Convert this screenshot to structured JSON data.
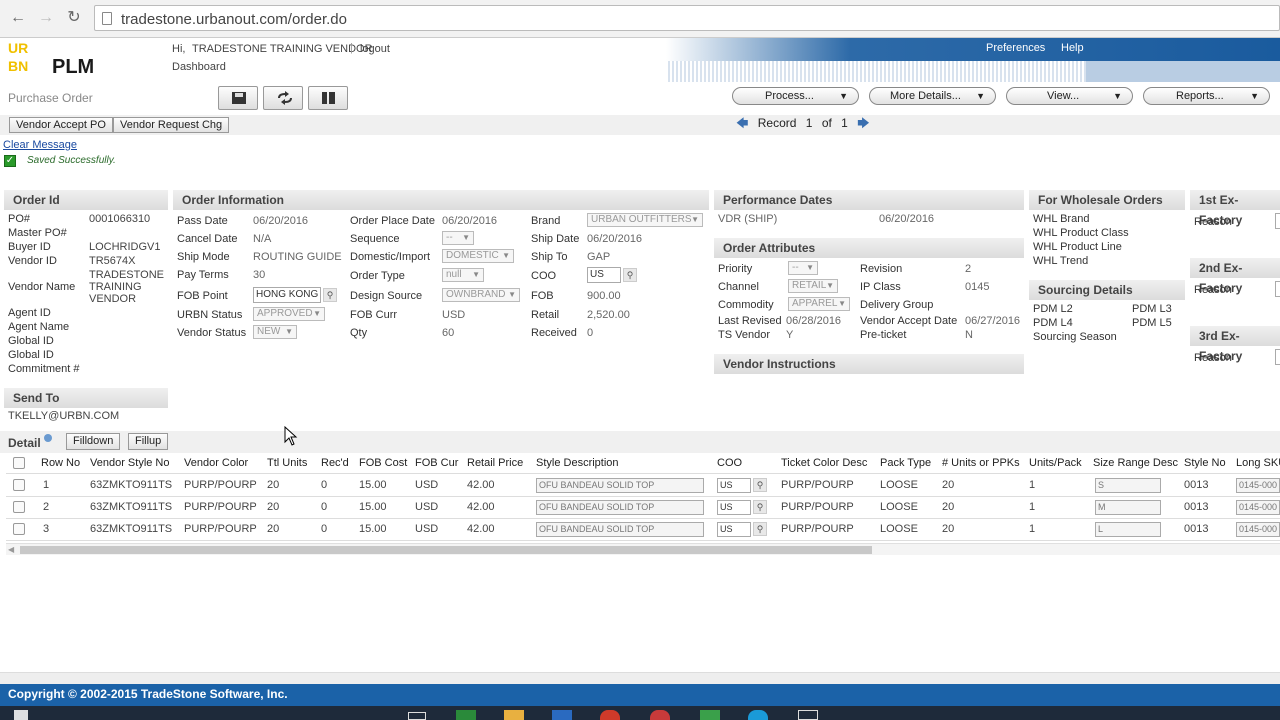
{
  "browser": {
    "url": "tradestone.urbanout.com/order.do"
  },
  "header": {
    "logo_letters": [
      "UR",
      "BN"
    ],
    "app_name": "PLM",
    "greeting": "Hi,",
    "user": "TRADESTONE TRAINING VENDOR",
    "logout": "logout",
    "dashboard": "Dashboard",
    "preferences": "Preferences",
    "help": "Help"
  },
  "toolbar": {
    "page_title": "Purchase Order",
    "menus": [
      "Process...",
      "More Details...",
      "View...",
      "Reports..."
    ],
    "vendor_accept": "Vendor Accept PO",
    "vendor_request": "Vendor Request Chg",
    "record_label": "Record",
    "record_current": "1",
    "record_of": "of",
    "record_total": "1"
  },
  "messages": {
    "clear": "Clear Message",
    "saved": "Saved Successfully."
  },
  "order_id": {
    "title": "Order Id",
    "po_label": "PO#",
    "po": "0001066310",
    "master_label": "Master PO#",
    "buyer_label": "Buyer ID",
    "buyer": "LOCHRIDGV1",
    "vendor_label": "Vendor ID",
    "vendor": "TR5674X",
    "vendor_name_label": "Vendor Name",
    "vendor_name": [
      "TRADESTONE",
      "TRAINING",
      "VENDOR"
    ],
    "agent_label": "Agent ID",
    "agent_name_label": "Agent Name",
    "global_label": "Global ID",
    "global_label2": "Global ID",
    "commitment_label": "Commitment #"
  },
  "send_to": {
    "title": "Send To",
    "email": "TKELLY@URBN.COM"
  },
  "order_info": {
    "title": "Order Information",
    "pass_date_label": "Pass Date",
    "pass_date": "06/20/2016",
    "cancel_date_label": "Cancel Date",
    "cancel_date": "N/A",
    "ship_mode_label": "Ship Mode",
    "ship_mode": "ROUTING GUIDE",
    "pay_terms_label": "Pay Terms",
    "pay_terms": "30",
    "fob_point_label": "FOB Point",
    "fob_point": "HONG KONG",
    "urbn_status_label": "URBN Status",
    "urbn_status": "APPROVED",
    "vendor_status_label": "Vendor Status",
    "vendor_status": "NEW",
    "order_place_label": "Order Place Date",
    "order_place": "06/20/2016",
    "sequence_label": "Sequence",
    "sequence": "--",
    "domestic_label": "Domestic/Import",
    "domestic": "DOMESTIC",
    "order_type_label": "Order Type",
    "order_type": "null",
    "design_source_label": "Design Source",
    "design_source": "OWNBRAND",
    "fob_curr_label": "FOB Curr",
    "fob_curr": "USD",
    "qty_label": "Qty",
    "qty": "60",
    "brand_label": "Brand",
    "brand": "URBAN OUTFITTERS",
    "ship_date_label": "Ship Date",
    "ship_date": "06/20/2016",
    "ship_to_label": "Ship To",
    "ship_to": "GAP",
    "coo_label": "COO",
    "coo": "US",
    "fob_label": "FOB",
    "fob": "900.00",
    "retail_label": "Retail",
    "retail": "2,520.00",
    "received_label": "Received",
    "received": "0"
  },
  "performance": {
    "title": "Performance Dates",
    "vdr_label": "VDR (SHIP)",
    "vdr": "06/20/2016"
  },
  "attributes": {
    "title": "Order Attributes",
    "priority_label": "Priority",
    "priority": "--",
    "channel_label": "Channel",
    "channel": "RETAIL",
    "commodity_label": "Commodity",
    "commodity": "APPAREL",
    "last_revised_label": "Last Revised",
    "last_revised": "06/28/2016",
    "ts_vendor_label": "TS Vendor",
    "ts_vendor": "Y",
    "revision_label": "Revision",
    "revision": "2",
    "ip_class_label": "IP Class",
    "ip_class": "0145",
    "delivery_group_label": "Delivery Group",
    "vendor_accept_label": "Vendor Accept Date",
    "vendor_accept": "06/27/2016",
    "preticket_label": "Pre-ticket",
    "preticket": "N"
  },
  "vendor_instructions": {
    "title": "Vendor Instructions"
  },
  "wholesale": {
    "title": "For Wholesale Orders",
    "items": [
      "WHL Brand",
      "WHL Product Class",
      "WHL Product Line",
      "WHL Trend"
    ]
  },
  "sourcing": {
    "title": "Sourcing Details",
    "l2": "PDM L2",
    "l3": "PDM L3",
    "l4": "PDM L4",
    "l5": "PDM L5",
    "season": "Sourcing Season"
  },
  "exfactory": [
    {
      "title": "1st Ex-Factory",
      "reason": "Reason"
    },
    {
      "title": "2nd Ex-Factory",
      "reason": "Reason"
    },
    {
      "title": "3rd Ex-Factory",
      "reason": "Reason"
    }
  ],
  "detail": {
    "title": "Detail",
    "filldown": "Filldown",
    "fillup": "Fillup",
    "columns": [
      "Row No",
      "Vendor Style No",
      "Vendor Color",
      "Ttl Units",
      "Rec'd",
      "FOB Cost",
      "FOB Cur",
      "Retail Price",
      "Style Description",
      "COO",
      "Ticket Color Desc",
      "Pack Type",
      "# Units or PPKs",
      "Units/Pack",
      "Size Range Desc",
      "Style No",
      "Long SKU"
    ],
    "rows": [
      [
        "1",
        "63ZMKTO911TS",
        "PURP/POURP",
        "20",
        "0",
        "15.00",
        "USD",
        "42.00",
        "OFU BANDEAU SOLID TOP",
        "US",
        "PURP/POURP",
        "LOOSE",
        "20",
        "1",
        "S",
        "0013",
        "0145-000"
      ],
      [
        "2",
        "63ZMKTO911TS",
        "PURP/POURP",
        "20",
        "0",
        "15.00",
        "USD",
        "42.00",
        "OFU BANDEAU SOLID TOP",
        "US",
        "PURP/POURP",
        "LOOSE",
        "20",
        "1",
        "M",
        "0013",
        "0145-000"
      ],
      [
        "3",
        "63ZMKTO911TS",
        "PURP/POURP",
        "20",
        "0",
        "15.00",
        "USD",
        "42.00",
        "OFU BANDEAU SOLID TOP",
        "US",
        "PURP/POURP",
        "LOOSE",
        "20",
        "1",
        "L",
        "0013",
        "0145-000"
      ]
    ]
  },
  "footer": {
    "copyright": "Copyright © 2002-2015 TradeStone Software, Inc."
  }
}
